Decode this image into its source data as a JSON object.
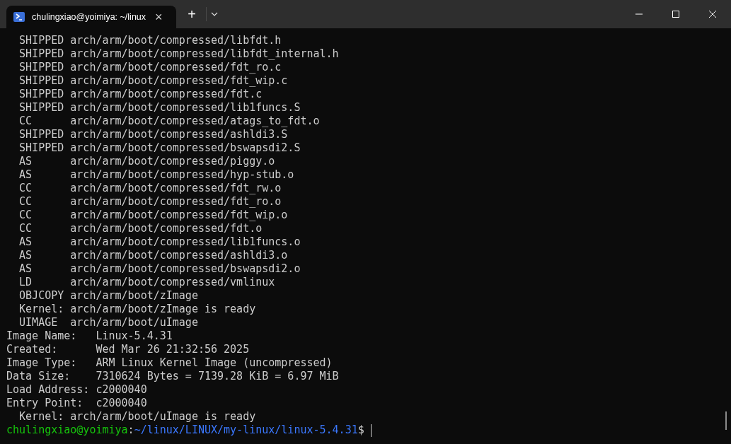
{
  "tab": {
    "title": "chulingxiao@yoimiya: ~/linux",
    "close": "×"
  },
  "new_tab": "+",
  "lines": [
    "  SHIPPED arch/arm/boot/compressed/libfdt.h",
    "  SHIPPED arch/arm/boot/compressed/libfdt_internal.h",
    "  SHIPPED arch/arm/boot/compressed/fdt_ro.c",
    "  SHIPPED arch/arm/boot/compressed/fdt_wip.c",
    "  SHIPPED arch/arm/boot/compressed/fdt.c",
    "  SHIPPED arch/arm/boot/compressed/lib1funcs.S",
    "  CC      arch/arm/boot/compressed/atags_to_fdt.o",
    "  SHIPPED arch/arm/boot/compressed/ashldi3.S",
    "  SHIPPED arch/arm/boot/compressed/bswapsdi2.S",
    "  AS      arch/arm/boot/compressed/piggy.o",
    "  AS      arch/arm/boot/compressed/hyp-stub.o",
    "  CC      arch/arm/boot/compressed/fdt_rw.o",
    "  CC      arch/arm/boot/compressed/fdt_ro.o",
    "  CC      arch/arm/boot/compressed/fdt_wip.o",
    "  CC      arch/arm/boot/compressed/fdt.o",
    "  AS      arch/arm/boot/compressed/lib1funcs.o",
    "  AS      arch/arm/boot/compressed/ashldi3.o",
    "  AS      arch/arm/boot/compressed/bswapsdi2.o",
    "  LD      arch/arm/boot/compressed/vmlinux",
    "  OBJCOPY arch/arm/boot/zImage",
    "  Kernel: arch/arm/boot/zImage is ready",
    "  UIMAGE  arch/arm/boot/uImage",
    "Image Name:   Linux-5.4.31",
    "Created:      Wed Mar 26 21:32:56 2025",
    "Image Type:   ARM Linux Kernel Image (uncompressed)",
    "Data Size:    7310624 Bytes = 7139.28 KiB = 6.97 MiB",
    "Load Address: c2000040",
    "Entry Point:  c2000040",
    "  Kernel: arch/arm/boot/uImage is ready"
  ],
  "prompt": {
    "user": "chulingxiao@yoimiya",
    "separator": ":",
    "path": "~/linux/LINUX/my-linux/linux-5.4.31",
    "symbol": "$"
  }
}
